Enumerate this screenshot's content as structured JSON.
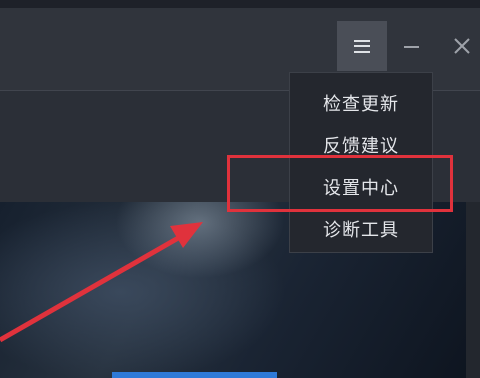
{
  "window": {
    "menu_icon": "hamburger-menu-icon",
    "minimize_icon": "minimize-icon",
    "close_icon": "close-icon"
  },
  "dropdown_menu": {
    "items": [
      {
        "label": "检查更新",
        "highlighted": false
      },
      {
        "label": "反馈建议",
        "highlighted": false
      },
      {
        "label": "设置中心",
        "highlighted": true
      },
      {
        "label": "诊断工具",
        "highlighted": false
      }
    ]
  },
  "annotation": {
    "highlight_color": "#e0323c",
    "arrow_color": "#e0323c",
    "highlight_target": "设置中心"
  },
  "colors": {
    "titlebar": "#30343c",
    "menu_button_active": "#4a4e57",
    "dropdown_background": "#24272e",
    "dropdown_text": "#e4e6ea",
    "accent_blue": "#2f7ad8"
  }
}
